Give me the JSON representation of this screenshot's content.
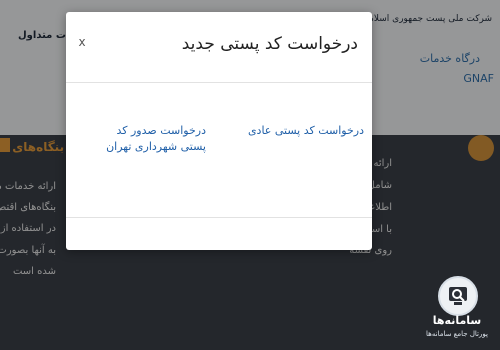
{
  "background": {
    "header_company": "شرکت ملی پست جمهوری اسلامی ایران",
    "header_frequent": "الات متداول",
    "sidebar_links": [
      "درگاه خدمات",
      "GNAF"
    ],
    "left_heading": "بنگاه‌های ا",
    "left_lines": [
      "ارائه خدمات مو",
      "بنگاه‌های اقتص",
      "در استفاده از ار",
      "به آنها بصورت",
      "شده است"
    ],
    "center_lines": [
      "ارائه خدمات کدپستی ب",
      "شامل دریافت کدپستی",
      "اطلاعات توصیفی، دریافت",
      "با استفاده از اطلاعات م",
      "روی نقشه"
    ]
  },
  "modal": {
    "title": "درخواست کد پستی جدید",
    "close_label": "x",
    "options": [
      {
        "label": "درخواست کد پستی عادی"
      },
      {
        "label": "درخواست صدور کد پستی شهرداری تهران"
      }
    ]
  },
  "watermark": {
    "title": "سامانه‌ها",
    "subtitle": "پورتال جامع سامانه‌ها",
    "icon": "search-magnifier-icon"
  }
}
